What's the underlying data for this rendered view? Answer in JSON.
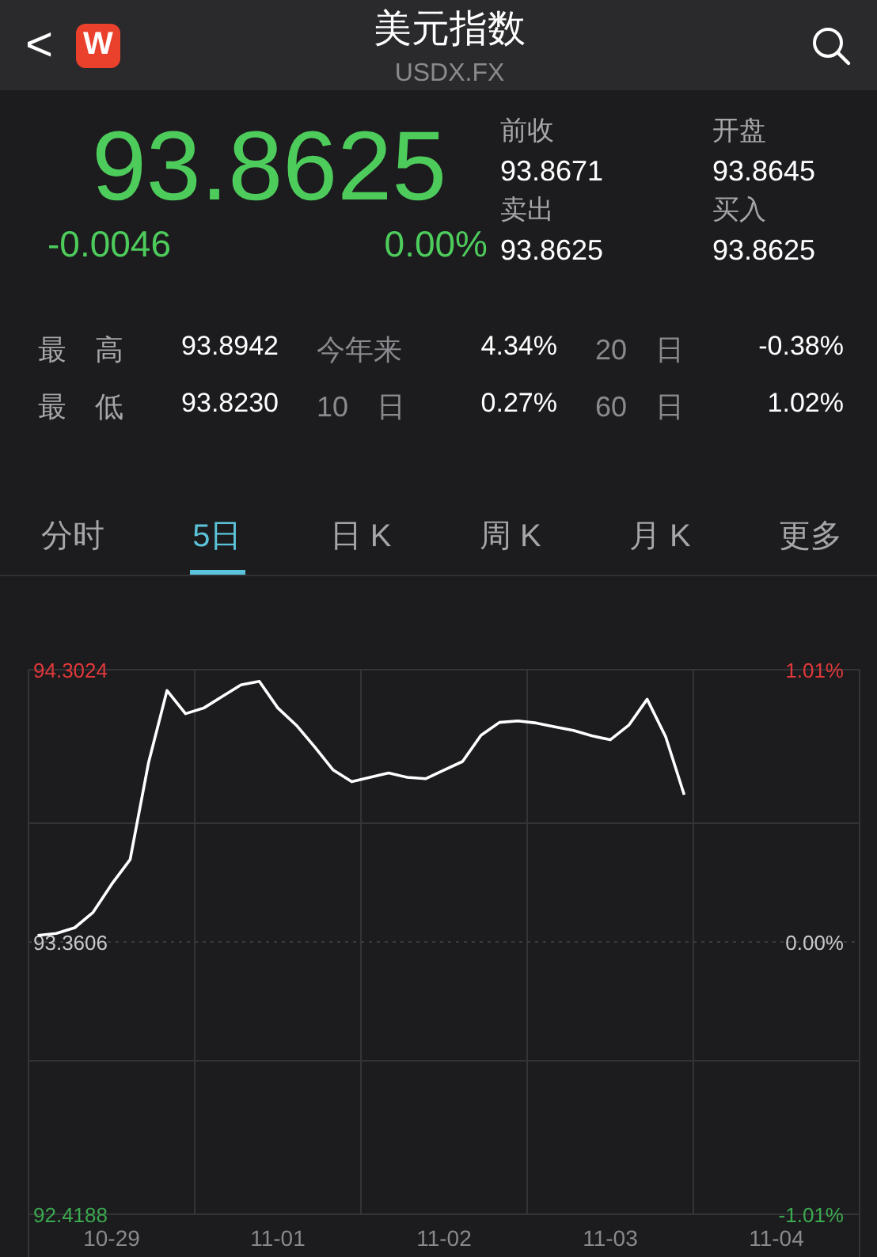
{
  "header": {
    "back": "<",
    "logo": "W",
    "title": "美元指数",
    "subtitle": "USDX.FX"
  },
  "quote": {
    "price": "93.8625",
    "change": "-0.0046",
    "change_pct": "0.00%"
  },
  "side_stats": [
    {
      "label": "前收",
      "value": "93.8671"
    },
    {
      "label": "开盘",
      "value": "93.8645"
    },
    {
      "label": "卖出",
      "value": "93.8625"
    },
    {
      "label": "买入",
      "value": "93.8625"
    }
  ],
  "stats": [
    [
      {
        "label": "最　高",
        "value": "93.8942"
      },
      {
        "label": "今年来",
        "value": "4.34%"
      },
      {
        "label": "20　日",
        "value": "-0.38%"
      }
    ],
    [
      {
        "label": "最　低",
        "value": "93.8230"
      },
      {
        "label": "10　日",
        "value": "0.27%"
      },
      {
        "label": "60　日",
        "value": "1.02%"
      }
    ]
  ],
  "tabs": [
    {
      "label": "分时",
      "selected": false
    },
    {
      "label": "5日",
      "selected": true
    },
    {
      "label": "日 K",
      "selected": false
    },
    {
      "label": "周 K",
      "selected": false
    },
    {
      "label": "月 K",
      "selected": false
    },
    {
      "label": "更多",
      "selected": false
    }
  ],
  "chart": {
    "right_labels": [
      {
        "text": "1.01%",
        "kind": "up"
      },
      {
        "text": "0.00%",
        "kind": "flat"
      },
      {
        "text": "-1.01%",
        "kind": "down"
      }
    ],
    "chart_data": {
      "type": "line",
      "ylim": [
        92.4188,
        94.3024
      ],
      "ref_lines": [
        {
          "axis": "y",
          "value": 93.3606
        }
      ],
      "categories": [
        null,
        null,
        null,
        null,
        "10-29",
        null,
        null,
        null,
        null,
        null,
        null,
        null,
        null,
        "11-01",
        null,
        null,
        null,
        null,
        null,
        null,
        null,
        null,
        "11-02",
        null,
        null,
        null,
        null,
        null,
        null,
        null,
        null,
        "11-03",
        null,
        null,
        null,
        null,
        null,
        null,
        null,
        null,
        "11-04",
        null,
        null,
        null,
        null
      ],
      "yticks": [
        {
          "value": 94.3024,
          "label": "94.3024"
        },
        {
          "value": 93.3606,
          "label": "93.3606"
        },
        {
          "value": 92.4188,
          "label": "92.4188"
        }
      ],
      "series": [
        {
          "color": "#ffffff",
          "values": [
            93.383,
            93.39,
            93.41,
            93.463,
            93.56,
            93.646,
            93.98,
            94.23,
            94.15,
            94.17,
            94.21,
            94.25,
            94.262,
            94.17,
            94.11,
            94.035,
            93.955,
            93.915,
            93.93,
            93.945,
            93.93,
            93.925,
            93.955,
            93.985,
            94.075,
            94.12,
            94.125,
            94.118,
            94.105,
            94.092,
            94.074,
            94.06,
            94.11,
            94.2,
            94.07,
            93.87,
            null,
            null,
            null,
            null,
            null,
            null,
            null,
            null,
            null
          ]
        }
      ]
    }
  }
}
